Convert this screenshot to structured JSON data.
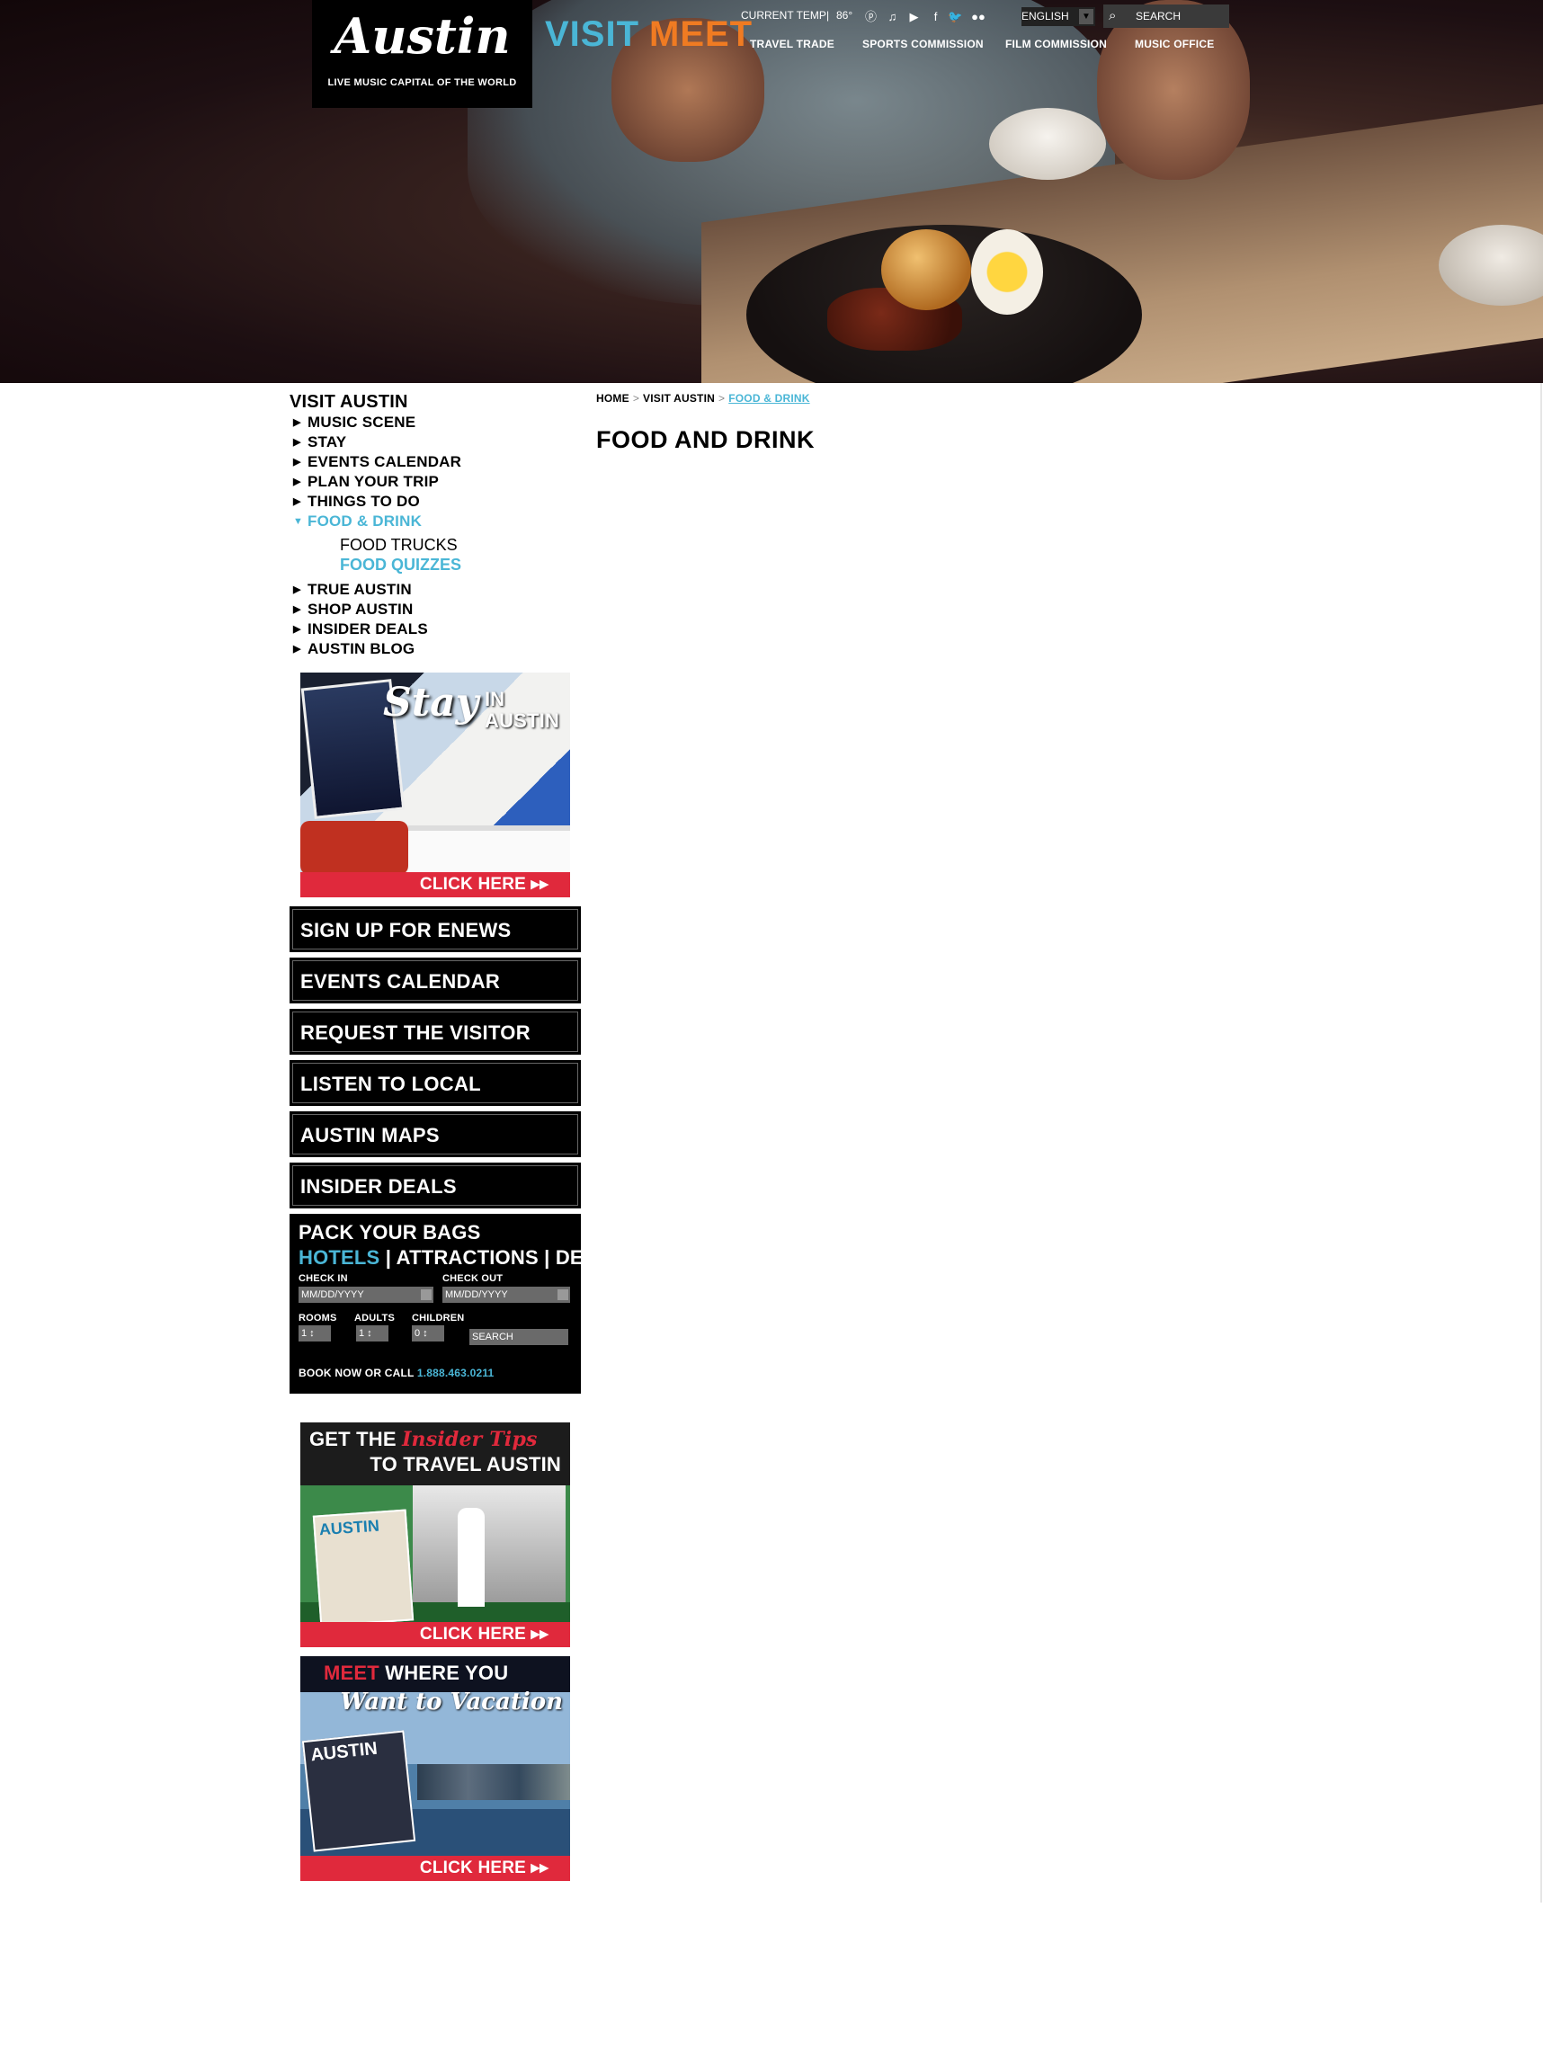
{
  "header": {
    "logo": {
      "wordmark": "Austin",
      "tagline": "LIVE MUSIC CAPITAL OF THE WORLD"
    },
    "primary_nav": [
      {
        "label": "VISIT",
        "color": "#4ab6d6"
      },
      {
        "label": "MEET",
        "color": "#f07b22"
      }
    ],
    "utility": {
      "temp_label": "CURRENT TEMP",
      "temp_separator": "|",
      "temp_value": "86°",
      "social_icons": [
        "pinterest-icon",
        "itunes-icon",
        "youtube-icon",
        "facebook-icon",
        "twitter-icon",
        "flickr-icon"
      ],
      "language": "ENGLISH",
      "search_placeholder": "SEARCH"
    },
    "sub_nav": [
      "TRAVEL TRADE",
      "SPORTS COMMISSION",
      "FILM COMMISSION",
      "MUSIC OFFICE"
    ]
  },
  "sidebar": {
    "heading": "VISIT AUSTIN",
    "items": [
      {
        "label": "MUSIC SCENE"
      },
      {
        "label": "STAY"
      },
      {
        "label": "EVENTS CALENDAR"
      },
      {
        "label": "PLAN YOUR TRIP"
      },
      {
        "label": "THINGS TO DO"
      },
      {
        "label": "FOOD & DRINK"
      },
      {
        "label": "TRUE AUSTIN"
      },
      {
        "label": "SHOP AUSTIN"
      },
      {
        "label": "INSIDER DEALS"
      },
      {
        "label": "AUSTIN BLOG"
      }
    ],
    "sub_items": [
      {
        "label": "FOOD TRUCKS"
      },
      {
        "label": "FOOD QUIZZES"
      }
    ],
    "promo_stay": {
      "title_script": "Stay",
      "title_in": "IN",
      "title_city": "AUSTIN",
      "cta": "CLICK HERE ▸▸"
    },
    "buttons": [
      {
        "label": "SIGN UP FOR ENEWS"
      },
      {
        "label": "EVENTS CALENDAR"
      },
      {
        "label": "REQUEST THE VISITOR GUIDE"
      },
      {
        "label": "LISTEN TO LOCAL GROOVES"
      },
      {
        "label": "AUSTIN MAPS"
      },
      {
        "label": "INSIDER DEALS"
      }
    ],
    "booking": {
      "title": "PACK YOUR BAGS",
      "tabs": [
        "HOTELS",
        "ATTRACTIONS",
        "DEALS"
      ],
      "tab_separator": "|",
      "check_in_label": "CHECK IN",
      "check_in_placeholder": "MM/DD/YYYY",
      "check_out_label": "CHECK OUT",
      "check_out_placeholder": "MM/DD/YYYY",
      "rooms_label": "ROOMS",
      "rooms_value": "1",
      "adults_label": "ADULTS",
      "adults_value": "1",
      "children_label": "CHILDREN",
      "children_value": "0",
      "search_label": "SEARCH",
      "call_text": "BOOK NOW OR CALL",
      "phone": "1.888.463.0211"
    },
    "promo_tips": {
      "line1_a": "GET THE",
      "line1_b": "Insider Tips",
      "line2": "TO TRAVEL AUSTIN",
      "magazine": "AUSTIN",
      "cta": "CLICK HERE ▸▸"
    },
    "promo_meet": {
      "line1_a": "MEET",
      "line1_b": "WHERE YOU",
      "line2": "Want to Vacation",
      "magazine": "AUSTIN",
      "cta": "CLICK HERE ▸▸"
    }
  },
  "main": {
    "breadcrumb": [
      "HOME",
      "VISIT AUSTIN",
      "FOOD & DRINK"
    ],
    "breadcrumb_separator": ">",
    "title": "FOOD AND DRINK"
  },
  "colors": {
    "accent_blue": "#4ab6d6",
    "accent_orange": "#f07b22",
    "cta_red": "#e0293c"
  }
}
